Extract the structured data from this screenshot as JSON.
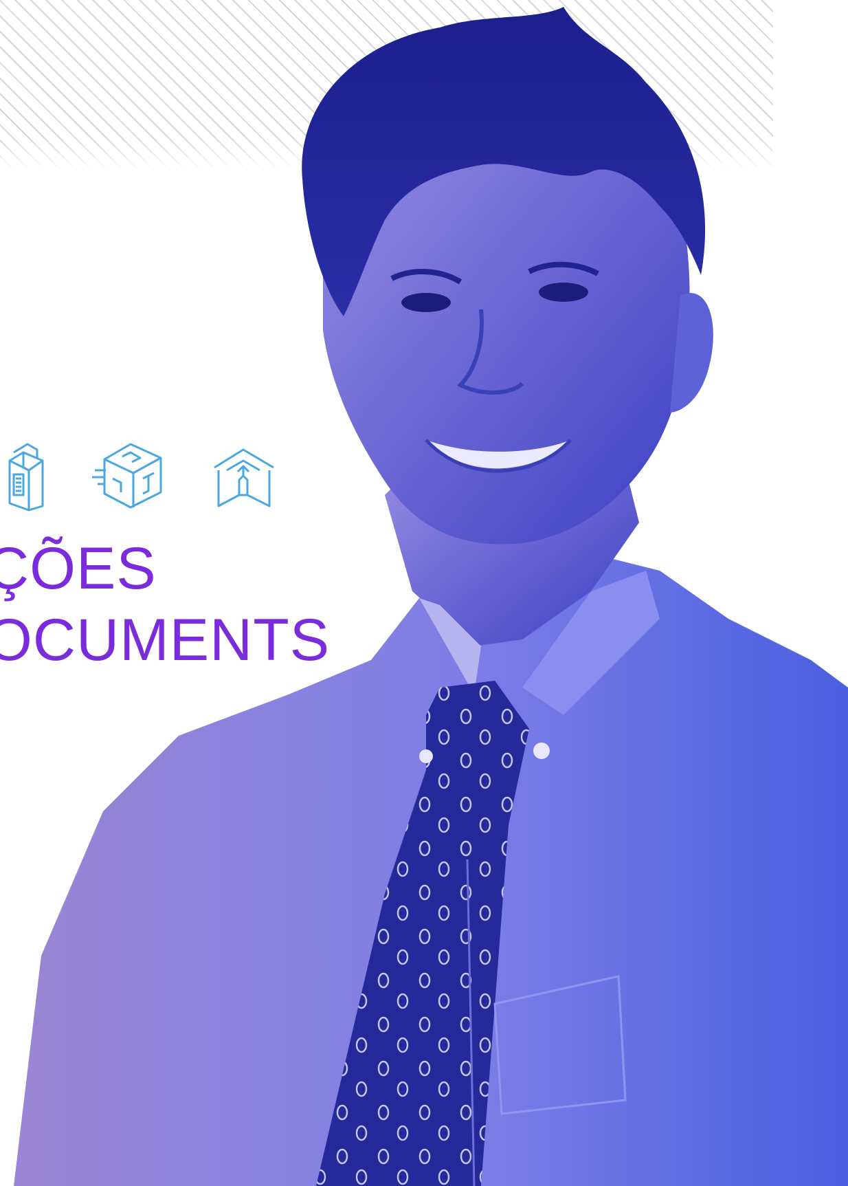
{
  "headline": {
    "line1": "ÇÕES",
    "line2": "OCUMENTS"
  },
  "icons": [
    {
      "name": "document-stack-icon"
    },
    {
      "name": "data-cube-icon"
    },
    {
      "name": "box-upload-icon"
    }
  ],
  "colors": {
    "headline": "#7a2cdc",
    "icon_stroke": "#4aa7e0",
    "photo_tint_dark": "#1f2aa8",
    "photo_tint_light": "#8a7bd8",
    "stripes": "#d6d6dc"
  }
}
